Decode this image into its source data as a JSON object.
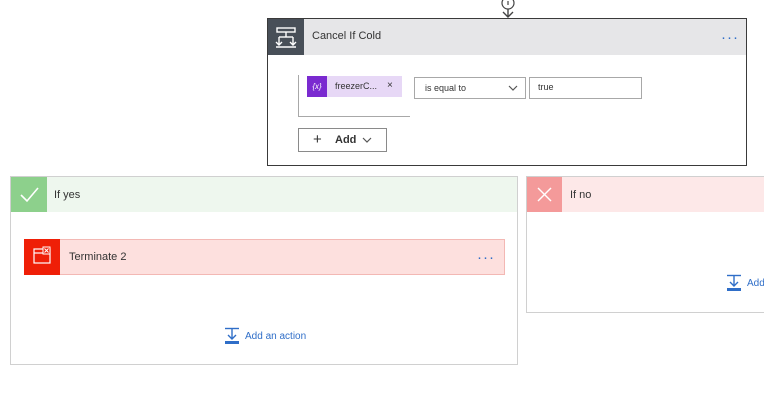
{
  "condition": {
    "title": "Cancel If Cold",
    "more_label": "···",
    "token": {
      "icon_text": "{x}",
      "label": "freezerC...",
      "remove_label": "×"
    },
    "operator": {
      "selected": "is equal to"
    },
    "value": "true",
    "add_button_label": "Add",
    "add_button_plus": "+"
  },
  "branches": {
    "yes": {
      "title": "If yes",
      "actions": [
        {
          "title": "Terminate 2",
          "more_label": "···"
        }
      ],
      "add_action_label": "Add an action"
    },
    "no": {
      "title": "If no",
      "add_action_label": "Add"
    }
  },
  "colors": {
    "accent": "#2f6ec8",
    "condition_icon_bg": "#484f58",
    "yes_icon_bg": "#8dd08c",
    "no_icon_bg": "#f49a9a",
    "terminate_icon_bg": "#ef1f07",
    "token_icon_bg": "#7a2ad0"
  },
  "icons": {
    "condition": "condition-icon",
    "yes": "check-icon",
    "no": "close-icon",
    "terminate": "terminate-icon",
    "add_action": "add-action-icon",
    "connector": "arrow-down-icon"
  }
}
